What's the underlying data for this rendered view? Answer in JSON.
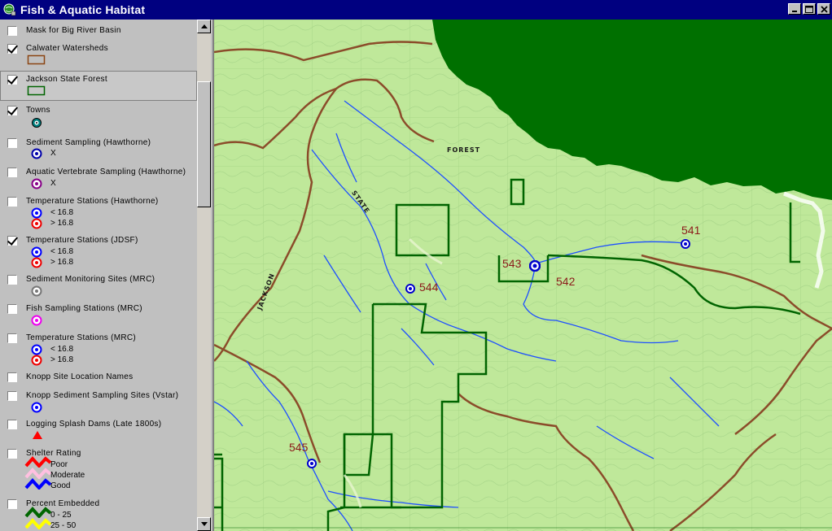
{
  "window": {
    "title": "Fish & Aquatic Habitat"
  },
  "legend": {
    "items": [
      {
        "label": "Mask for Big River Basin",
        "checked": false
      },
      {
        "label": "Calwater Watersheds",
        "checked": true
      },
      {
        "label": "Jackson State Forest",
        "checked": true
      },
      {
        "label": "Towns",
        "checked": true
      },
      {
        "label": "Sediment Sampling (Hawthorne)",
        "checked": false,
        "sym_label": "X"
      },
      {
        "label": "Aquatic Vertebrate Sampling (Hawthorne)",
        "checked": false,
        "sym_label": "X"
      },
      {
        "label": "Temperature Stations (Hawthorne)",
        "checked": false,
        "sym_labels": [
          "< 16.8",
          "> 16.8"
        ]
      },
      {
        "label": "Temperature Stations (JDSF)",
        "checked": true,
        "sym_labels": [
          "< 16.8",
          "> 16.8"
        ]
      },
      {
        "label": "Sediment Monitoring Sites (MRC)",
        "checked": false
      },
      {
        "label": "Fish Sampling Stations (MRC)",
        "checked": false
      },
      {
        "label": "Temperature Stations (MRC)",
        "checked": false,
        "sym_labels": [
          "< 16.8",
          "> 16.8"
        ]
      },
      {
        "label": "Knopp Site Location Names",
        "checked": false
      },
      {
        "label": "Knopp Sediment Sampling Sites (Vstar)",
        "checked": false
      },
      {
        "label": "Logging Splash Dams (Late 1800s)",
        "checked": false
      },
      {
        "label": "Shelter Rating",
        "checked": false,
        "sym_labels": [
          "Poor",
          "Moderate",
          "Good"
        ]
      },
      {
        "label": "Percent Embedded",
        "checked": false,
        "sym_labels": [
          "0 - 25",
          "25 - 50"
        ]
      }
    ]
  },
  "map": {
    "station_labels": [
      "541",
      "543",
      "542",
      "544",
      "545"
    ],
    "place_text": [
      "FOREST",
      "STATE",
      "JACKSON"
    ],
    "colors": {
      "terrain": "#bfe89a",
      "mask": "#006400",
      "watershed": "#8b4513",
      "forest_boundary": "#006400",
      "stream": "#1e50ff",
      "station": "#0000c0"
    }
  }
}
